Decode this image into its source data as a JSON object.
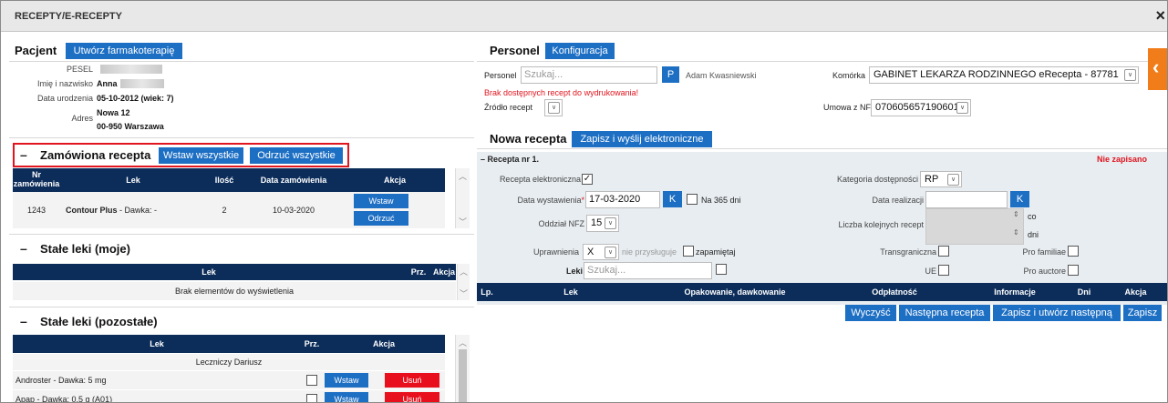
{
  "window": {
    "title": "RECEPTY/E-RECEPTY",
    "close": "×"
  },
  "patient": {
    "tab": "Pacjent",
    "create_button": "Utwórz farmakoterapię",
    "pesel_label": "PESEL",
    "name_label": "Imię i nazwisko",
    "name_value": "Anna",
    "dob_label": "Data urodzenia",
    "dob_value": "05-10-2012 (wiek: 7)",
    "address_label": "Adres",
    "address_line1": "Nowa 12",
    "address_line2": "00-950 Warszawa"
  },
  "ordered": {
    "collapse": "–",
    "title": "Zamówiona recepta",
    "insert_all": "Wstaw wszystkie",
    "reject_all": "Odrzuć wszystkie",
    "columns": {
      "nr": "Nr zamówienia",
      "drug": "Lek",
      "qty": "Ilość",
      "date": "Data zamówienia",
      "action": "Akcja"
    },
    "rows": [
      {
        "nr": "1243",
        "drug": "Contour Plus",
        "dose": " - Dawka: -",
        "qty": "2",
        "date": "10-03-2020",
        "insert": "Wstaw",
        "reject": "Odrzuć"
      }
    ]
  },
  "my_drugs": {
    "collapse": "–",
    "title": "Stałe leki (moje)",
    "columns": {
      "drug": "Lek",
      "prz": "Prz.",
      "action": "Akcja"
    },
    "empty": "Brak elementów do wyświetlenia"
  },
  "other_drugs": {
    "collapse": "–",
    "title": "Stałe leki (pozostałe)",
    "columns": {
      "drug": "Lek",
      "prz": "Prz.",
      "action": "Akcja"
    },
    "group": "Leczniczy Dariusz",
    "rows": [
      {
        "drug": "Androster",
        "dose": " - Dawka: 5 mg",
        "insert": "Wstaw",
        "remove": "Usuń"
      },
      {
        "drug": "Apap",
        "dose": " - Dawka: 0,5 g (A01)",
        "insert": "Wstaw",
        "remove": "Usuń"
      }
    ]
  },
  "staff": {
    "tab": "Personel",
    "config_tab": "Konfiguracja",
    "person_label": "Personel",
    "search_placeholder": "Szukaj...",
    "p_button": "P",
    "person_name": "Adam Kwasniewski",
    "warning": "Brak dostępnych recept do wydrukowania!",
    "source_label": "Źródło recept",
    "unit_label": "Komórka",
    "unit_value": "GABINET LEKARZA RODZINNEGO eRecepta - 87781",
    "contract_label": "Umowa z NFZ",
    "contract_value": "070605657190601"
  },
  "new_rx": {
    "tab": "Nowa recepta",
    "send_tab": "Zapisz i wyślij elektroniczne",
    "section": "– Recepta nr 1.",
    "not_saved": "Nie zapisano",
    "electronic_label": "Recepta elektroniczna",
    "issue_date_label": "Data wystawienia",
    "issue_date_value": "17-03-2020",
    "k_button": "K",
    "na365_label": "Na 365 dni",
    "nfz_label": "Oddział NFZ",
    "nfz_value": "15",
    "perm_label": "Uprawnienia",
    "perm_value": "X",
    "perm_hint": "nie przysługuje",
    "remember_label": "zapamiętaj",
    "drugs_label": "Leki",
    "drugs_placeholder": "Szukaj...",
    "category_label": "Kategoria dostępności",
    "category_value": "RP",
    "realization_label": "Data realizacji",
    "next_count_label": "Liczba kolejnych recept",
    "co_label": "co",
    "days_label": "dni",
    "cross_border_label": "Transgraniczna",
    "pro_familiae_label": "Pro familiae",
    "ue_label": "UE",
    "pro_auctore_label": "Pro auctore",
    "columns": {
      "lp": "Lp.",
      "drug": "Lek",
      "pack": "Opakowanie, dawkowanie",
      "payment": "Odpłatność",
      "info": "Informacje",
      "days": "Dni",
      "action": "Akcja"
    },
    "clear": "Wyczyść",
    "next_rx": "Następna recepta",
    "save_create_next": "Zapisz i utwórz następną",
    "save": "Zapisz"
  },
  "colors": {
    "accent": "#1d6fc4",
    "navy": "#0c2d5a",
    "danger": "#e8101c",
    "highlight": "#e0151f",
    "orange": "#f07d1a"
  }
}
